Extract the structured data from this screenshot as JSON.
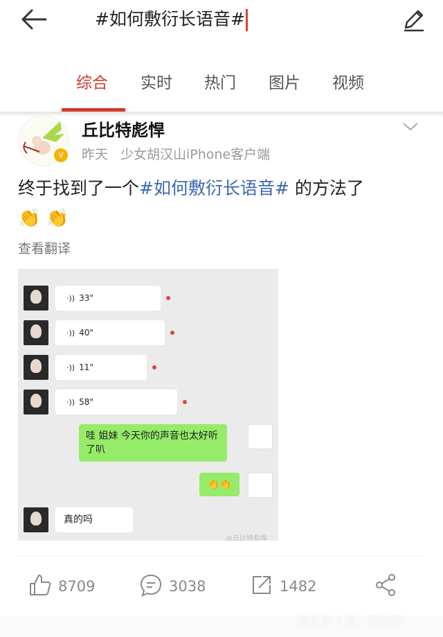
{
  "search": {
    "query": "#如何敷衍长语音#"
  },
  "tabs": [
    {
      "label": "综合",
      "active": true
    },
    {
      "label": "实时",
      "active": false
    },
    {
      "label": "热门",
      "active": false
    },
    {
      "label": "图片",
      "active": false
    },
    {
      "label": "视频",
      "active": false
    }
  ],
  "post": {
    "author": "丘比特彪悍",
    "time": "昨天",
    "source": "少女胡汉山iPhone客户端",
    "text_before": "终于找到了一个",
    "hashtag": "#如何敷衍长语音#",
    "text_after": " 的方法了",
    "emoji": "👏 👏",
    "translate": "查看翻译",
    "image": {
      "voice_messages": [
        "33\"",
        "40\"",
        "11\"",
        "58\""
      ],
      "reply_text": "哇 姐妹 今天你的声音也太好听了叭",
      "reply_emoji": "👏👏",
      "last_message": "真的吗",
      "watermark": "@丘比特彪悍"
    },
    "actions": {
      "likes": "8709",
      "comments": "3038",
      "reposts": "1482"
    }
  },
  "footer_watermark": "趣头条 | 投入权益偏",
  "colors": {
    "accent": "#d23b2c",
    "hashtag": "#3d68b4",
    "wechat_green": "#95ec69"
  },
  "icons": [
    "back-arrow-icon",
    "edit-pencil-icon",
    "verified-badge-icon",
    "chevron-down-icon",
    "thumb-up-icon",
    "comment-icon",
    "repost-icon",
    "share-icon",
    "voice-icon"
  ]
}
